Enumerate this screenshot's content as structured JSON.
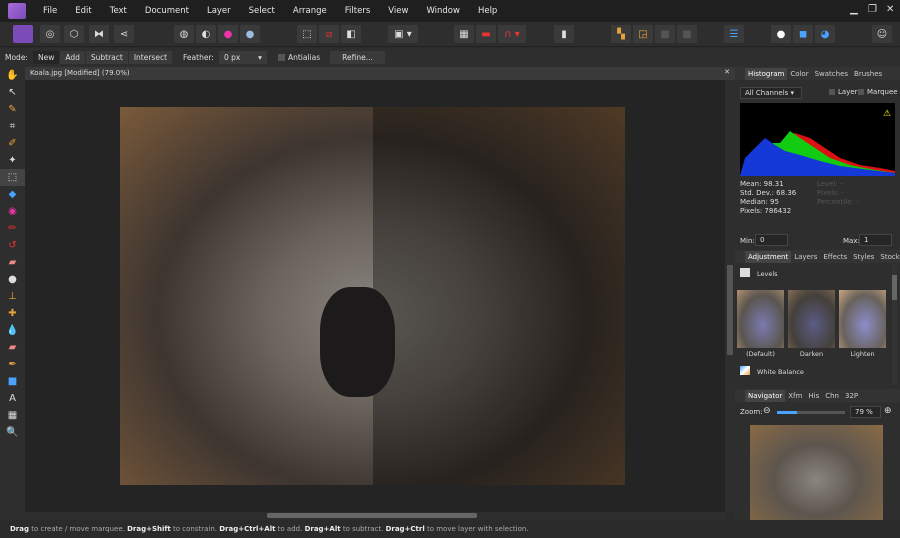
{
  "menu": [
    "File",
    "Edit",
    "Text",
    "Document",
    "Layer",
    "Select",
    "Arrange",
    "Filters",
    "View",
    "Window",
    "Help"
  ],
  "context": {
    "mode_label": "Mode:",
    "modes": [
      "New",
      "Add",
      "Subtract",
      "Intersect"
    ],
    "feather_label": "Feather:",
    "feather_value": "0 px",
    "antialias": "Antialias",
    "refine": "Refine..."
  },
  "document": {
    "tab": "Koala.jpg [Modified] (79.0%)"
  },
  "histogram": {
    "tabs": [
      "Histogram",
      "Color",
      "Swatches",
      "Brushes"
    ],
    "channel": "All Channels",
    "layer": "Layer",
    "marquee": "Marquee",
    "stats": [
      "Mean: 98.31",
      "Std. Dev.: 68.36",
      "Median: 95",
      "Pixels: 786432"
    ],
    "stats_right": [
      "Level: -",
      "Pixels: -",
      "Percentile: -"
    ],
    "min_label": "Min:",
    "min": "0",
    "max_label": "Max:",
    "max": "1"
  },
  "adjustment": {
    "tabs": [
      "Adjustment",
      "Layers",
      "Effects",
      "Styles",
      "Stock"
    ],
    "levels": "Levels",
    "presets": [
      "(Default)",
      "Darken",
      "Lighten"
    ],
    "white_balance": "White Balance"
  },
  "navigator": {
    "tabs": [
      "Navigator",
      "Xfm",
      "His",
      "Chn",
      "32P"
    ],
    "zoom_label": "Zoom:",
    "zoom_value": "79 %",
    "zoom_fraction": 0.3
  },
  "status": {
    "parts": [
      [
        "Drag",
        " to create / move marquee. "
      ],
      [
        "Drag+Shift",
        " to constrain. "
      ],
      [
        "Drag+Ctrl+Alt",
        " to add. "
      ],
      [
        "Drag+Alt",
        " to subtract. "
      ],
      [
        "Drag+Ctrl",
        " to move layer with selection."
      ]
    ]
  }
}
